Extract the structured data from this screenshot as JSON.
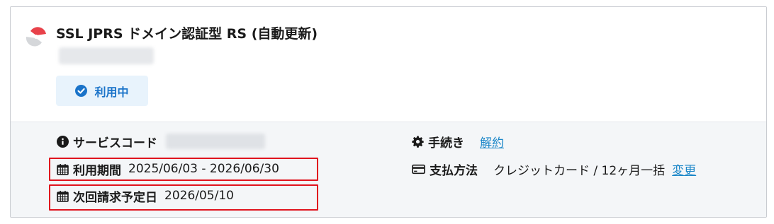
{
  "product": {
    "title": "SSL JPRS ドメイン認証型 RS (自動更新)",
    "status_label": "利用中"
  },
  "details": {
    "service_code_label": "サービスコード",
    "period_label": "利用期間",
    "period_value": "2025/06/03 - 2026/06/30",
    "next_billing_label": "次回請求予定日",
    "next_billing_value": "2026/05/10",
    "procedure_label": "手続き",
    "cancel_link": "解約",
    "payment_label": "支払方法",
    "payment_value": "クレジットカード / 12ヶ月一括",
    "change_link": "変更"
  },
  "colors": {
    "accent": "#1a86c8",
    "status_bg": "#e8f3fc",
    "highlight": "#e0141e",
    "logo": "#e8424a"
  },
  "icons": {
    "service_code": "info-circle-icon",
    "period": "calendar-icon",
    "next_billing": "calendar-icon",
    "procedure": "gear-icon",
    "payment": "credit-card-icon",
    "status": "check-circle-icon"
  }
}
